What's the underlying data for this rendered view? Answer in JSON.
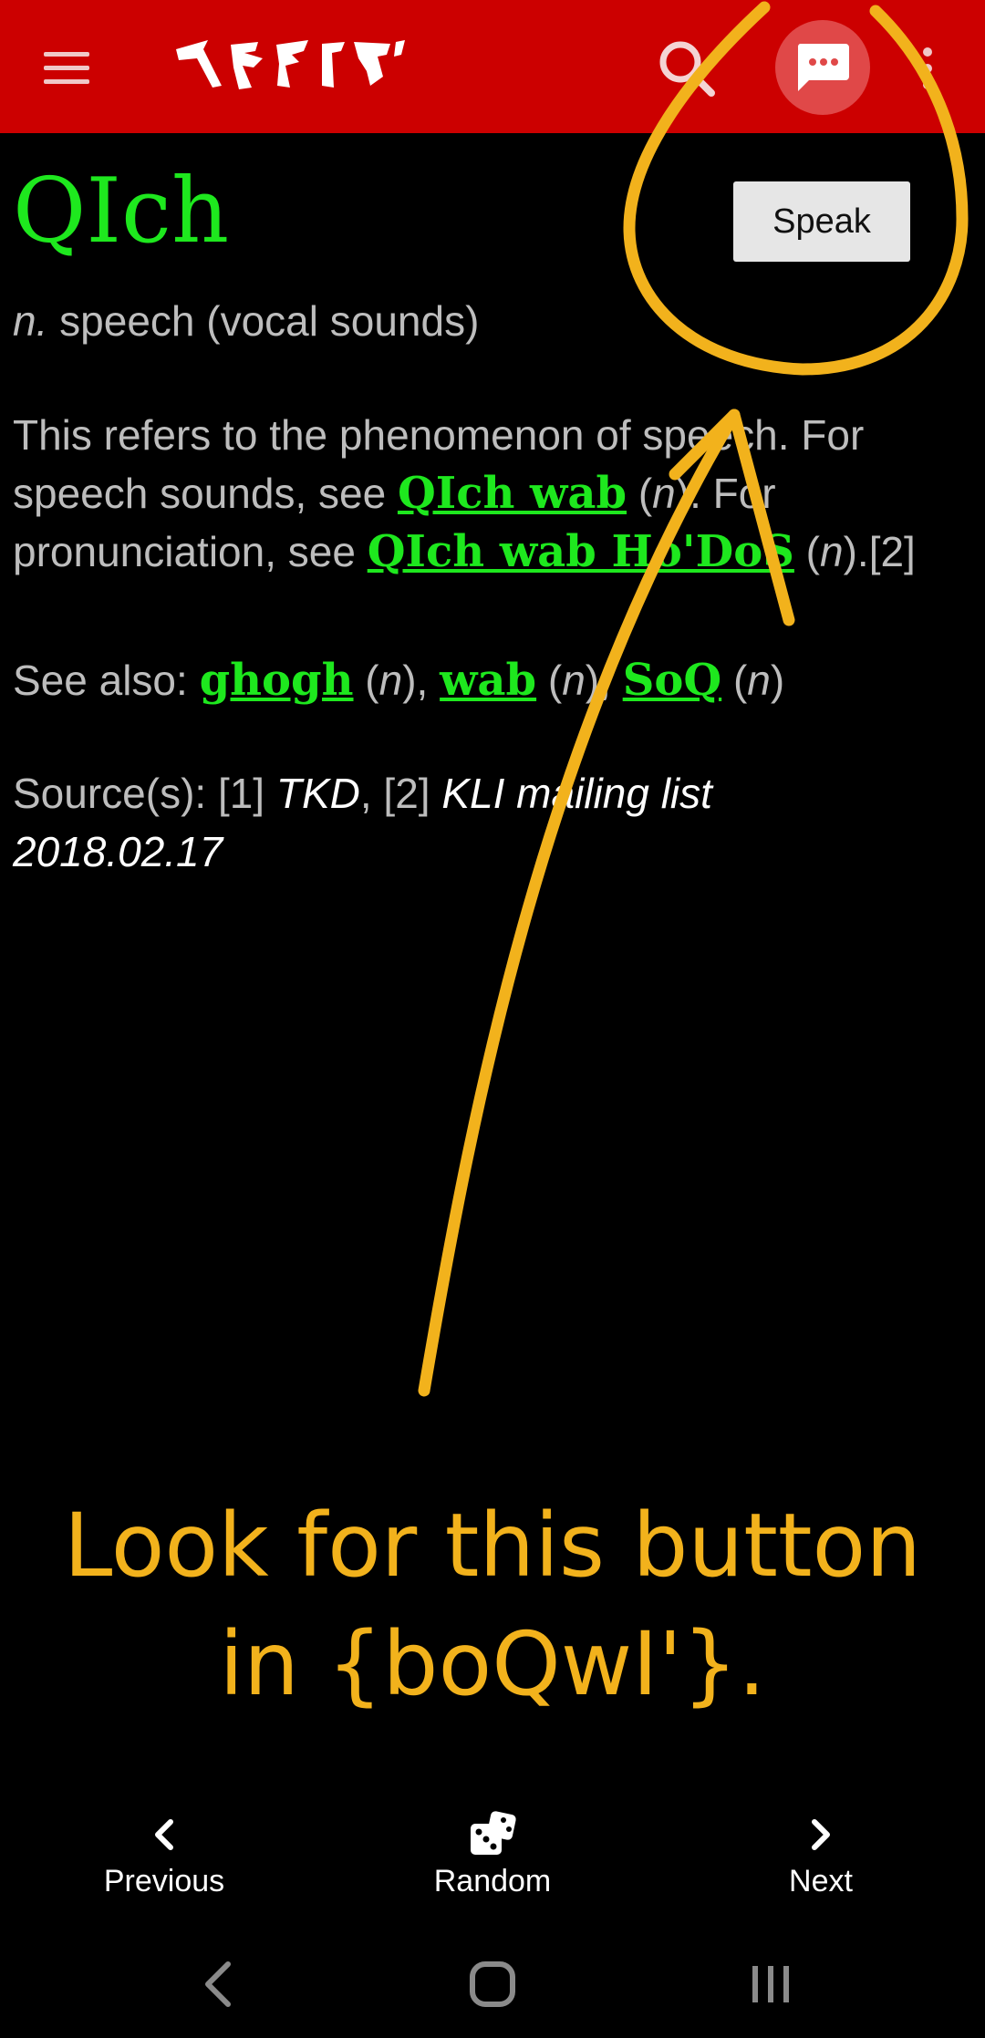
{
  "appbar": {
    "logo_text": "ᑦᑭᑯᑕᕐᕈ",
    "menu_icon": "hamburger-menu-icon",
    "search_icon": "search-icon",
    "speak_icon": "speech-bubble-icon",
    "overflow_icon": "more-vert-icon",
    "color": "#cc0000"
  },
  "entry": {
    "word": "QIch",
    "speak_label": "Speak",
    "pos": "n.",
    "gloss": "speech (vocal sounds)",
    "p1_a": "This refers to the phenomenon of speech. For speech sounds, see ",
    "link1": "QIch wab",
    "paren_open": "(",
    "pos_n": "n",
    "p1_b": "). For pronunciation, see ",
    "link2": "QIch wab Ho'DoS",
    "p1_c": ").[2]",
    "see_also_label": "See also: ",
    "link3": "ghogh",
    "link4": "wab",
    "link5": "SoQ",
    "sep": "), ",
    "close": ")",
    "sources_label": "Source(s): [1] ",
    "src1": "TKD",
    "src_mid": ", [2] ",
    "src2": "KLI mailing list 2018.02.17"
  },
  "annotation": {
    "line1": "Look for this button",
    "line2": "in {boQwI'}.",
    "color": "#f2b21c"
  },
  "bottom_nav": {
    "previous": "Previous",
    "random": "Random",
    "next": "Next"
  }
}
